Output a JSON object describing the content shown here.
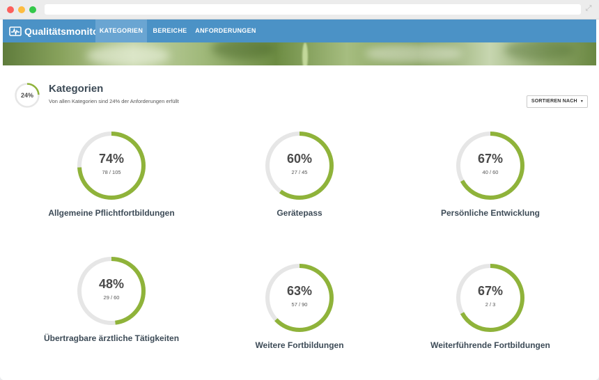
{
  "app": {
    "title": "Qualitätsmonitor",
    "accent": "#4b92c6",
    "ring_color": "#8fb33a",
    "track_color": "#e6e6e6"
  },
  "nav": {
    "items": [
      {
        "label": "KATEGORIEN",
        "active": true
      },
      {
        "label": "BEREICHE",
        "active": false
      },
      {
        "label": "ANFORDERUNGEN",
        "active": false
      }
    ]
  },
  "summary": {
    "percent_label": "24%",
    "percent": 24,
    "title": "Kategorien",
    "subtitle": "Von allen Kategorien sind 24% der Anforderungen erfüllt"
  },
  "sort": {
    "label": "SORTIEREN NACH",
    "icon": "caret-down-icon"
  },
  "categories": [
    {
      "percent_label": "74%",
      "ratio": "78 / 105",
      "name": "Allgemeine Pflichtfortbildungen",
      "percent": 74
    },
    {
      "percent_label": "60%",
      "ratio": "27 / 45",
      "name": "Gerätepass",
      "percent": 60
    },
    {
      "percent_label": "67%",
      "ratio": "40 / 60",
      "name": "Persönliche Entwicklung",
      "percent": 67
    },
    {
      "percent_label": "48%",
      "ratio": "29 / 60",
      "name": "Übertragbare ärztliche Tätigkeiten",
      "percent": 48
    },
    {
      "percent_label": "63%",
      "ratio": "57 / 90",
      "name": "Weitere Fortbildungen",
      "percent": 63
    },
    {
      "percent_label": "67%",
      "ratio": "2 / 3",
      "name": "Weiterführende Fortbildungen",
      "percent": 67
    }
  ]
}
